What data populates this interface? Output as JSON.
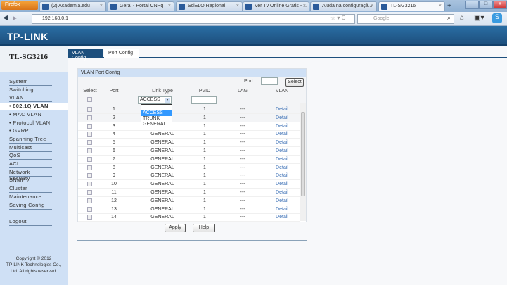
{
  "browser": {
    "menu": "Firefox",
    "tabs": [
      "(2) Academia.edu",
      "Geral - Portal CNPq",
      "SciELO Regional",
      "Ver Tv Online Gratis - ...",
      "Ajuda na configuraçã...",
      "TL-SG3216"
    ],
    "url": "192.168.0.1",
    "search_placeholder": "Google"
  },
  "header": {
    "brand": "TP-LINK"
  },
  "sidebar": {
    "model": "TL-SG3216",
    "items": [
      {
        "label": "System"
      },
      {
        "label": "Switching"
      },
      {
        "label": "VLAN"
      },
      {
        "label": "• 802.1Q VLAN",
        "selected": true
      },
      {
        "label": "• MAC VLAN"
      },
      {
        "label": "• Protocol VLAN"
      },
      {
        "label": "• GVRP"
      },
      {
        "label": "Spanning Tree"
      },
      {
        "label": "Multicast"
      },
      {
        "label": "QoS"
      },
      {
        "label": "ACL"
      },
      {
        "label": "Network Security"
      },
      {
        "label": "SNMP"
      },
      {
        "label": "Cluster"
      },
      {
        "label": "Maintenance"
      },
      {
        "label": "Saving Config"
      }
    ],
    "logout": "Logout",
    "copyright": [
      "Copyright © 2012",
      "TP-LINK Technologies Co.,",
      "Ltd. All rights reserved."
    ]
  },
  "main": {
    "tabs": [
      "VLAN Config",
      "Port Config"
    ],
    "active_tab": "Port Config",
    "panel_title": "VLAN Port Config",
    "port_label": "Port",
    "select_button": "Select",
    "columns": [
      "Select",
      "Port",
      "Link Type",
      "PVID",
      "LAG",
      "VLAN"
    ],
    "filter": {
      "link_type": "ACCESS",
      "pvid": ""
    },
    "dropdown_options": [
      "ACCESS",
      "TRUNK",
      "GENERAL"
    ],
    "dropdown_highlighted": "ACCESS",
    "rows": [
      {
        "port": "1",
        "link_type": "",
        "pvid": "1",
        "lag": "---",
        "vlan": "Detail"
      },
      {
        "port": "2",
        "link_type": "",
        "pvid": "1",
        "lag": "---",
        "vlan": "Detail"
      },
      {
        "port": "3",
        "link_type": "",
        "pvid": "1",
        "lag": "---",
        "vlan": "Detail"
      },
      {
        "port": "4",
        "link_type": "GENERAL",
        "pvid": "1",
        "lag": "---",
        "vlan": "Detail"
      },
      {
        "port": "5",
        "link_type": "GENERAL",
        "pvid": "1",
        "lag": "---",
        "vlan": "Detail"
      },
      {
        "port": "6",
        "link_type": "GENERAL",
        "pvid": "1",
        "lag": "---",
        "vlan": "Detail"
      },
      {
        "port": "7",
        "link_type": "GENERAL",
        "pvid": "1",
        "lag": "---",
        "vlan": "Detail"
      },
      {
        "port": "8",
        "link_type": "GENERAL",
        "pvid": "1",
        "lag": "---",
        "vlan": "Detail"
      },
      {
        "port": "9",
        "link_type": "GENERAL",
        "pvid": "1",
        "lag": "---",
        "vlan": "Detail"
      },
      {
        "port": "10",
        "link_type": "GENERAL",
        "pvid": "1",
        "lag": "---",
        "vlan": "Detail"
      },
      {
        "port": "11",
        "link_type": "GENERAL",
        "pvid": "1",
        "lag": "---",
        "vlan": "Detail"
      },
      {
        "port": "12",
        "link_type": "GENERAL",
        "pvid": "1",
        "lag": "---",
        "vlan": "Detail"
      },
      {
        "port": "13",
        "link_type": "GENERAL",
        "pvid": "1",
        "lag": "---",
        "vlan": "Detail"
      },
      {
        "port": "14",
        "link_type": "GENERAL",
        "pvid": "1",
        "lag": "---",
        "vlan": "Detail"
      }
    ],
    "apply_button": "Apply",
    "help_button": "Help"
  },
  "colors": {
    "header": "#1d4f7d",
    "sidebar": "#cfe0f5",
    "link": "#3a6fb5",
    "highlight": "#3399ff"
  }
}
